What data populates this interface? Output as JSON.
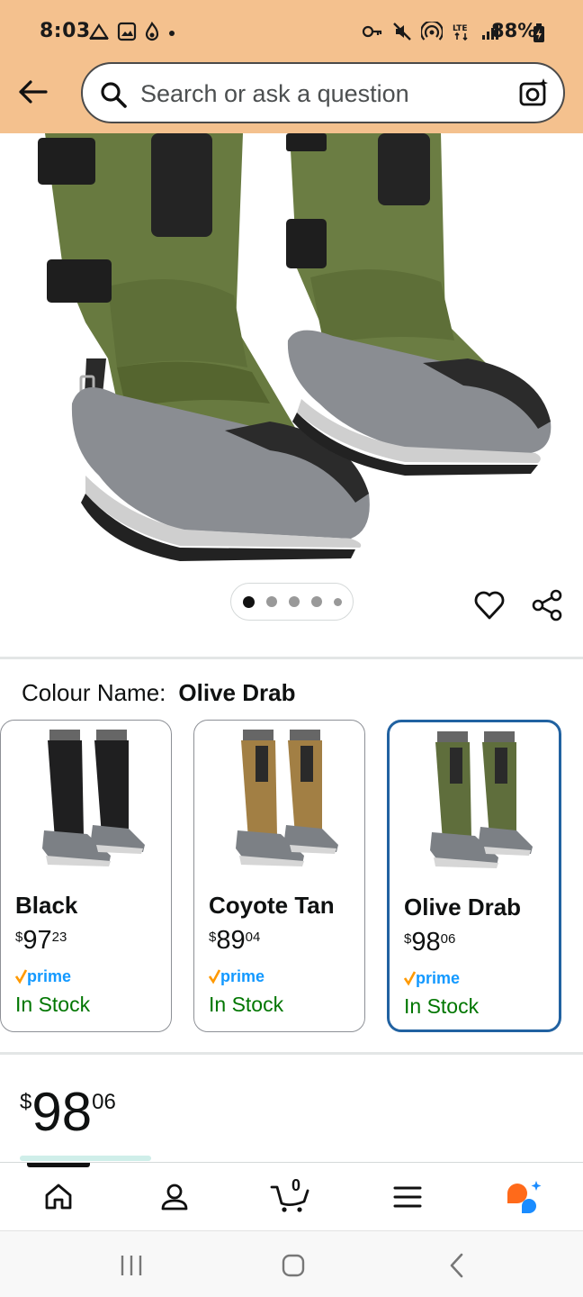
{
  "status_bar": {
    "time": "8:03",
    "battery": "88%",
    "network": "LTE"
  },
  "search": {
    "placeholder": "Search or ask a question"
  },
  "gallery": {
    "image_count": 5,
    "active_index": 0
  },
  "variation": {
    "label": "Colour Name:",
    "selected": "Olive Drab",
    "options": [
      {
        "name": "Black",
        "currency": "$",
        "whole": "97",
        "fraction": "23",
        "prime": "prime",
        "stock": "In Stock",
        "color": "#1f1f20"
      },
      {
        "name": "Coyote Tan",
        "currency": "$",
        "whole": "89",
        "fraction": "04",
        "prime": "prime",
        "stock": "In Stock",
        "color": "#a27f44"
      },
      {
        "name": "Olive Drab",
        "currency": "$",
        "whole": "98",
        "fraction": "06",
        "prime": "prime",
        "stock": "In Stock",
        "color": "#5f6e3c"
      }
    ]
  },
  "price": {
    "currency": "$",
    "whole": "98",
    "fraction": "06"
  },
  "bottom_nav": {
    "cart_count": "0",
    "items": [
      "home-icon",
      "account-icon",
      "cart-icon",
      "menu-icon",
      "rufus-icon"
    ]
  },
  "colors": {
    "header_bg": "#f4c18e",
    "selected_border": "#2162a1",
    "prime_blue": "#1399ff",
    "prime_check": "#ff9900",
    "stock_green": "#007600"
  }
}
